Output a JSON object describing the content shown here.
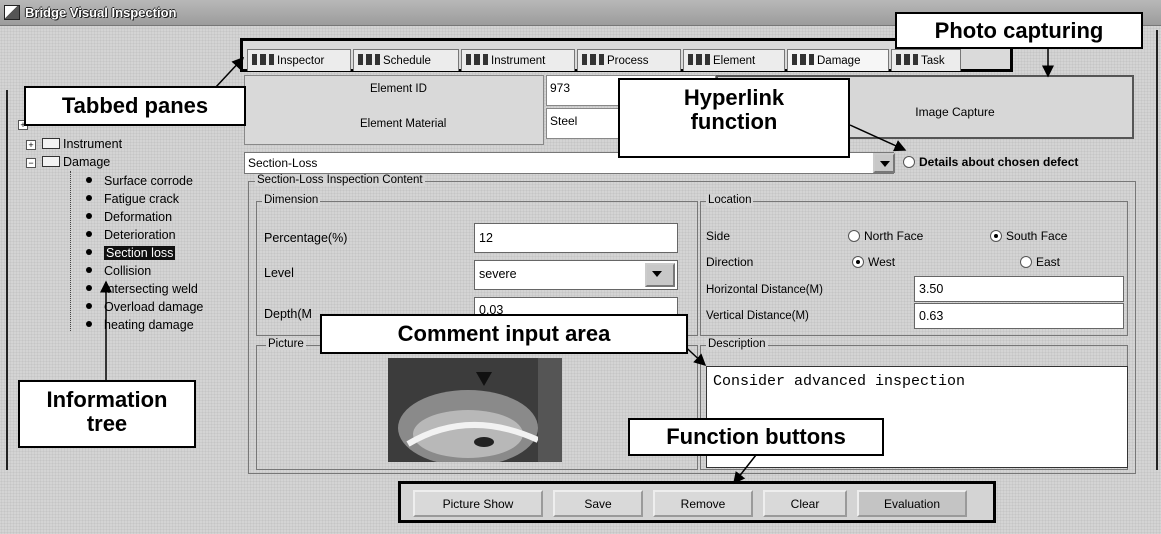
{
  "window": {
    "title": "Bridge Visual Inspection"
  },
  "tabs": [
    "Inspector",
    "Schedule",
    "Instrument",
    "Process",
    "Element",
    "Damage",
    "Task"
  ],
  "active_tab": "Damage",
  "tree": {
    "folders": [
      "Instrument",
      "Damage"
    ],
    "damage_items": [
      "Surface corrode",
      "Fatigue crack",
      "Deformation",
      "Deterioration",
      "Section loss",
      "Collision",
      "Intersecting weld",
      "Overload damage",
      "heating damage"
    ],
    "selected": "Section loss"
  },
  "element": {
    "id_label": "Element ID",
    "id_value": "973",
    "material_label": "Element Material",
    "material_value": "Steel"
  },
  "image_capture_label": "Image Capture",
  "defect": {
    "selected": "Section-Loss",
    "details_label": "Details about chosen defect"
  },
  "content": {
    "title": "Section-Loss Inspection Content",
    "dimension": {
      "title": "Dimension",
      "percentage_label": "Percentage(%)",
      "percentage_value": "12",
      "level_label": "Level",
      "level_value": "severe",
      "depth_label": "Depth(M",
      "depth_value": "0.03"
    },
    "location": {
      "title": "Location",
      "side_label": "Side",
      "north": "North Face",
      "south": "South Face",
      "direction_label": "Direction",
      "west": "West",
      "east": "East",
      "horizontal_label": "Horizontal Distance(M)",
      "horizontal_value": "3.50",
      "vertical_label": "Vertical Distance(M)",
      "vertical_value": "0.63"
    },
    "picture_title": "Picture",
    "description_title": "Description",
    "description_value": "Consider advanced inspection"
  },
  "buttons": {
    "picture_show": "Picture Show",
    "save": "Save",
    "remove": "Remove",
    "clear": "Clear",
    "evaluation": "Evaluation"
  },
  "annotations": {
    "tabbed_panes": "Tabbed panes",
    "photo_capturing": "Photo capturing",
    "hyperlink_1": "Hyperlink",
    "hyperlink_2": "function",
    "comment_input": "Comment input area",
    "information_1": "Information",
    "information_2": "tree",
    "function_buttons": "Function buttons"
  }
}
